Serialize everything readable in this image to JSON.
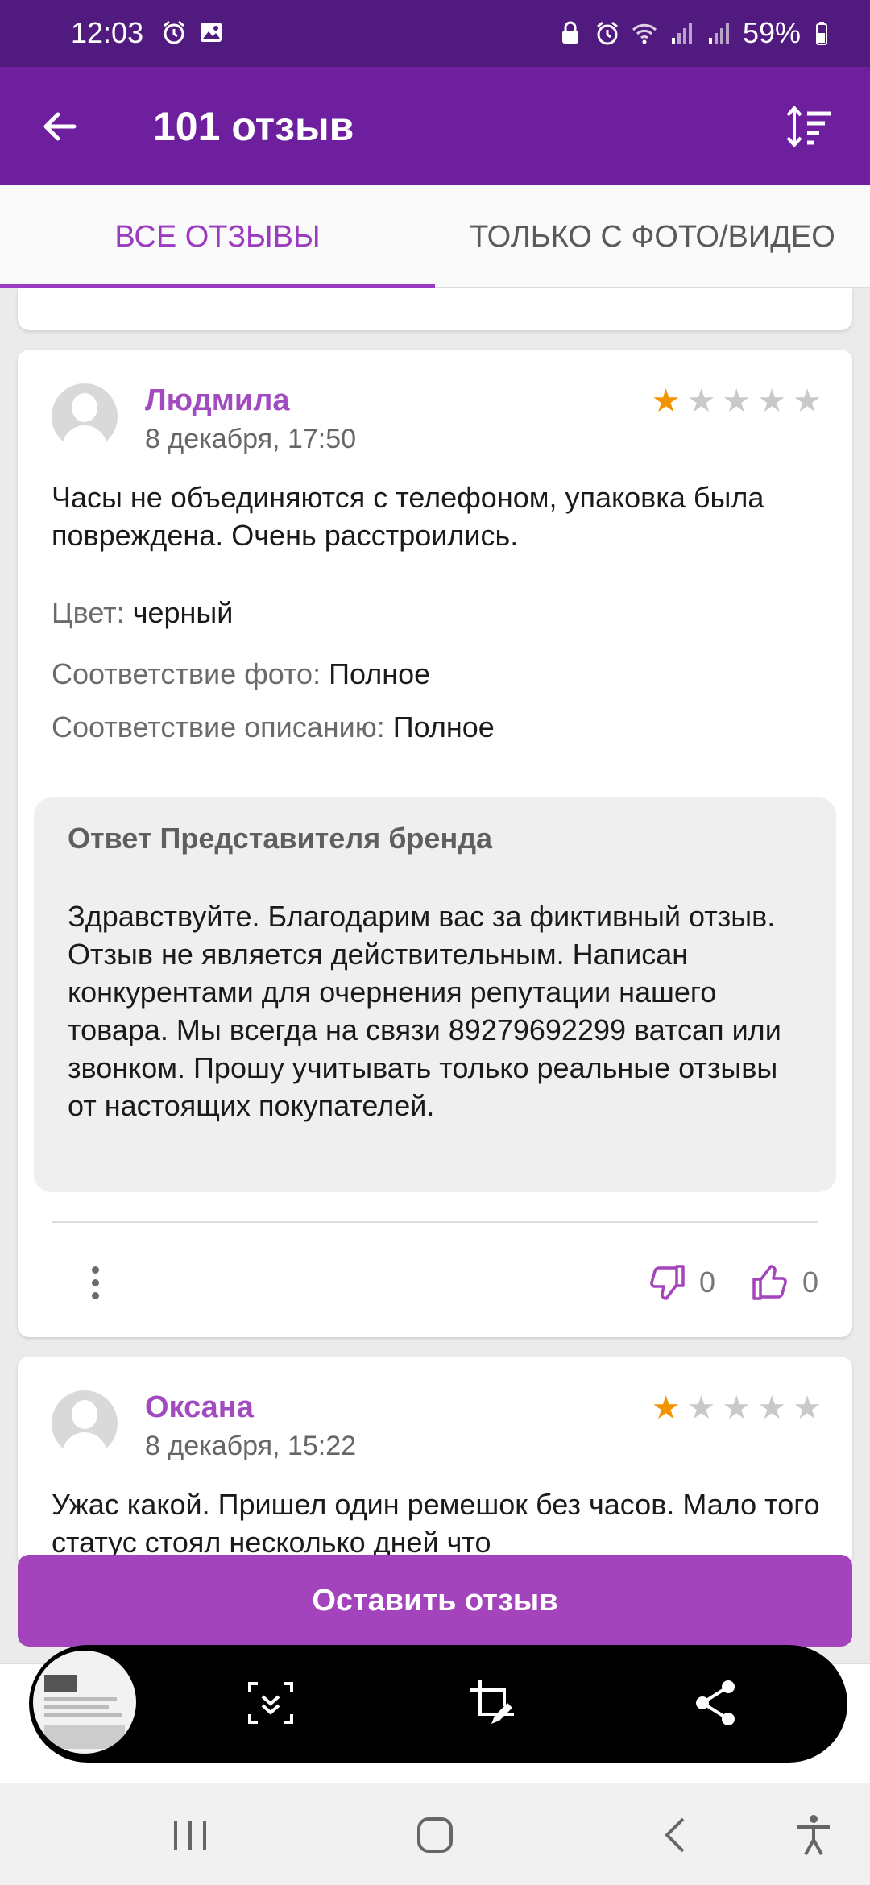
{
  "status_bar": {
    "time": "12:03",
    "battery": "59%",
    "icons_left": [
      "alarm-icon",
      "image-icon"
    ],
    "icons_right": [
      "lock-icon",
      "alarm-icon",
      "wifi-icon",
      "signal-icon",
      "signal-icon",
      "battery-icon"
    ]
  },
  "app_bar": {
    "title": "101 отзыв",
    "back_icon": "arrow-back-icon",
    "sort_icon": "sort-icon"
  },
  "tabs": [
    {
      "label": "ВСЕ ОТЗЫВЫ",
      "active": true
    },
    {
      "label": "ТОЛЬКО С ФОТО/ВИДЕО",
      "active": false
    }
  ],
  "reviews": [
    {
      "author": "Людмила",
      "date": "8 декабря, 17:50",
      "rating": 1,
      "text": "Часы не объединяются с телефоном, упаковка была повреждена. Очень расстроились.",
      "details": [
        {
          "label": "Цвет:",
          "value": "черный"
        },
        {
          "label": "Соответствие фото:",
          "value": "Полное"
        },
        {
          "label": "Соответствие описанию:",
          "value": "Полное"
        }
      ],
      "reply": {
        "title": "Ответ Представителя бренда",
        "text": "Здравствуйте. Благодарим вас за фиктивный отзыв. Отзыв не является действительным. Написан конкурентами для очернения репутации нашего товара. Мы всегда на связи 89279692299 ватсап или звонком. Прошу учитывать только реальные отзывы от настоящих покупателей."
      },
      "dislikes": "0",
      "likes": "0"
    },
    {
      "author": "Оксана",
      "date": "8 декабря, 15:22",
      "rating": 1,
      "text": "Ужас какой. Пришел один ремешок без часов. Мало того статус стоял несколько дней что"
    }
  ],
  "cta": {
    "label": "Оставить отзыв"
  },
  "screenshot_toolbar": {
    "tools": [
      "scroll-capture-icon",
      "crop-edit-icon",
      "share-icon"
    ]
  },
  "system_nav": [
    "recents-icon",
    "home-icon",
    "back-icon",
    "accessibility-icon"
  ],
  "colors": {
    "status_bar": "#501a7e",
    "app_bar": "#6e1f9d",
    "accent": "#a24bc0",
    "cta": "#a444bd",
    "star_on": "#f29400"
  }
}
